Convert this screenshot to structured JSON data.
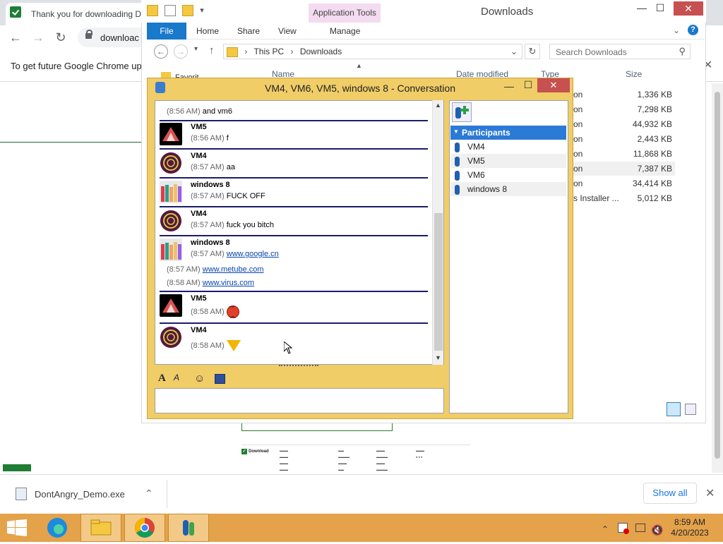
{
  "chrome": {
    "tab_title": "Thank you for downloading D",
    "url_fragment": "downloac",
    "infobar_text": "To get future Google Chrome up",
    "infobar_close": "✕",
    "download_file": "DontAngry_Demo.exe",
    "show_all": "Show all",
    "dl_close": "✕",
    "dl_chevron": "⌃",
    "nav_back": "←",
    "nav_forward": "→",
    "nav_reload": "↻"
  },
  "explorer": {
    "title": "Downloads",
    "app_tools": "Application Tools",
    "tabs": {
      "file": "File",
      "home": "Home",
      "share": "Share",
      "view": "View",
      "manage": "Manage"
    },
    "path": {
      "root": "This PC",
      "folder": "Downloads"
    },
    "search_placeholder": "Search Downloads",
    "headers": {
      "name": "Name",
      "date": "Date modified",
      "type": "Type",
      "size": "Size"
    },
    "sidebar_partial": "Favorit",
    "rows": [
      {
        "type": "on",
        "size": "1,336 KB"
      },
      {
        "type": "on",
        "size": "7,298 KB"
      },
      {
        "type": "on",
        "size": "44,932 KB"
      },
      {
        "type": "on",
        "size": "2,443 KB"
      },
      {
        "type": "on",
        "size": "11,868 KB"
      },
      {
        "type": "on",
        "size": "7,387 KB"
      },
      {
        "type": "on",
        "size": "34,414 KB"
      },
      {
        "type": "s Installer ...",
        "size": "5,012 KB"
      }
    ],
    "buttons": {
      "minimize": "—",
      "maximize": "☐",
      "close": "✕",
      "refresh": "↻",
      "up": "↑",
      "back": "←",
      "forward": "→",
      "dropdown": "⌄",
      "help": "?"
    }
  },
  "conversation": {
    "title": "VM4, VM6, VM5, windows 8 - Conversation",
    "buttons": {
      "minimize": "—",
      "maximize": "☐",
      "close": "✕"
    },
    "messages": [
      {
        "continuation": true,
        "time": "(8:56 AM)",
        "text": "and vm6"
      },
      {
        "sender": "VM5",
        "time": "(8:56 AM)",
        "text": "f",
        "avatar": "crane"
      },
      {
        "sender": "VM4",
        "time": "(8:57 AM)",
        "text": "aa",
        "avatar": "ball"
      },
      {
        "sender": "windows 8",
        "time": "(8:57 AM)",
        "text": "FUCK OFF",
        "avatar": "crayons"
      },
      {
        "sender": "VM4",
        "time": "(8:57 AM)",
        "text": "fuck you bitch",
        "avatar": "ball"
      },
      {
        "sender": "windows 8",
        "time": "(8:57 AM)",
        "link": "www.google.cn",
        "avatar": "crayons"
      },
      {
        "continuation": true,
        "time": "(8:57 AM)",
        "link": "www.metube.com"
      },
      {
        "continuation": true,
        "time": "(8:58 AM)",
        "link": "www.virus.com"
      },
      {
        "sender": "VM5",
        "time": "(8:58 AM)",
        "emoji": "angry-face",
        "avatar": "crane"
      },
      {
        "sender": "VM4",
        "time": "(8:58 AM)",
        "emoji": "pizza",
        "avatar": "ball"
      }
    ],
    "participants_header": "Participants",
    "participants": [
      "VM4",
      "VM5",
      "VM6",
      "windows 8"
    ]
  },
  "taskbar": {
    "time": "8:59 AM",
    "date": "4/20/2023",
    "tray_chevron": "⌃"
  },
  "colors": {
    "conversation_frame": "#f0cd67",
    "taskbar": "#e4a24b",
    "explorer_file_tab": "#1979ca",
    "participants_header": "#2b7ad6",
    "close_button": "#c75050"
  }
}
